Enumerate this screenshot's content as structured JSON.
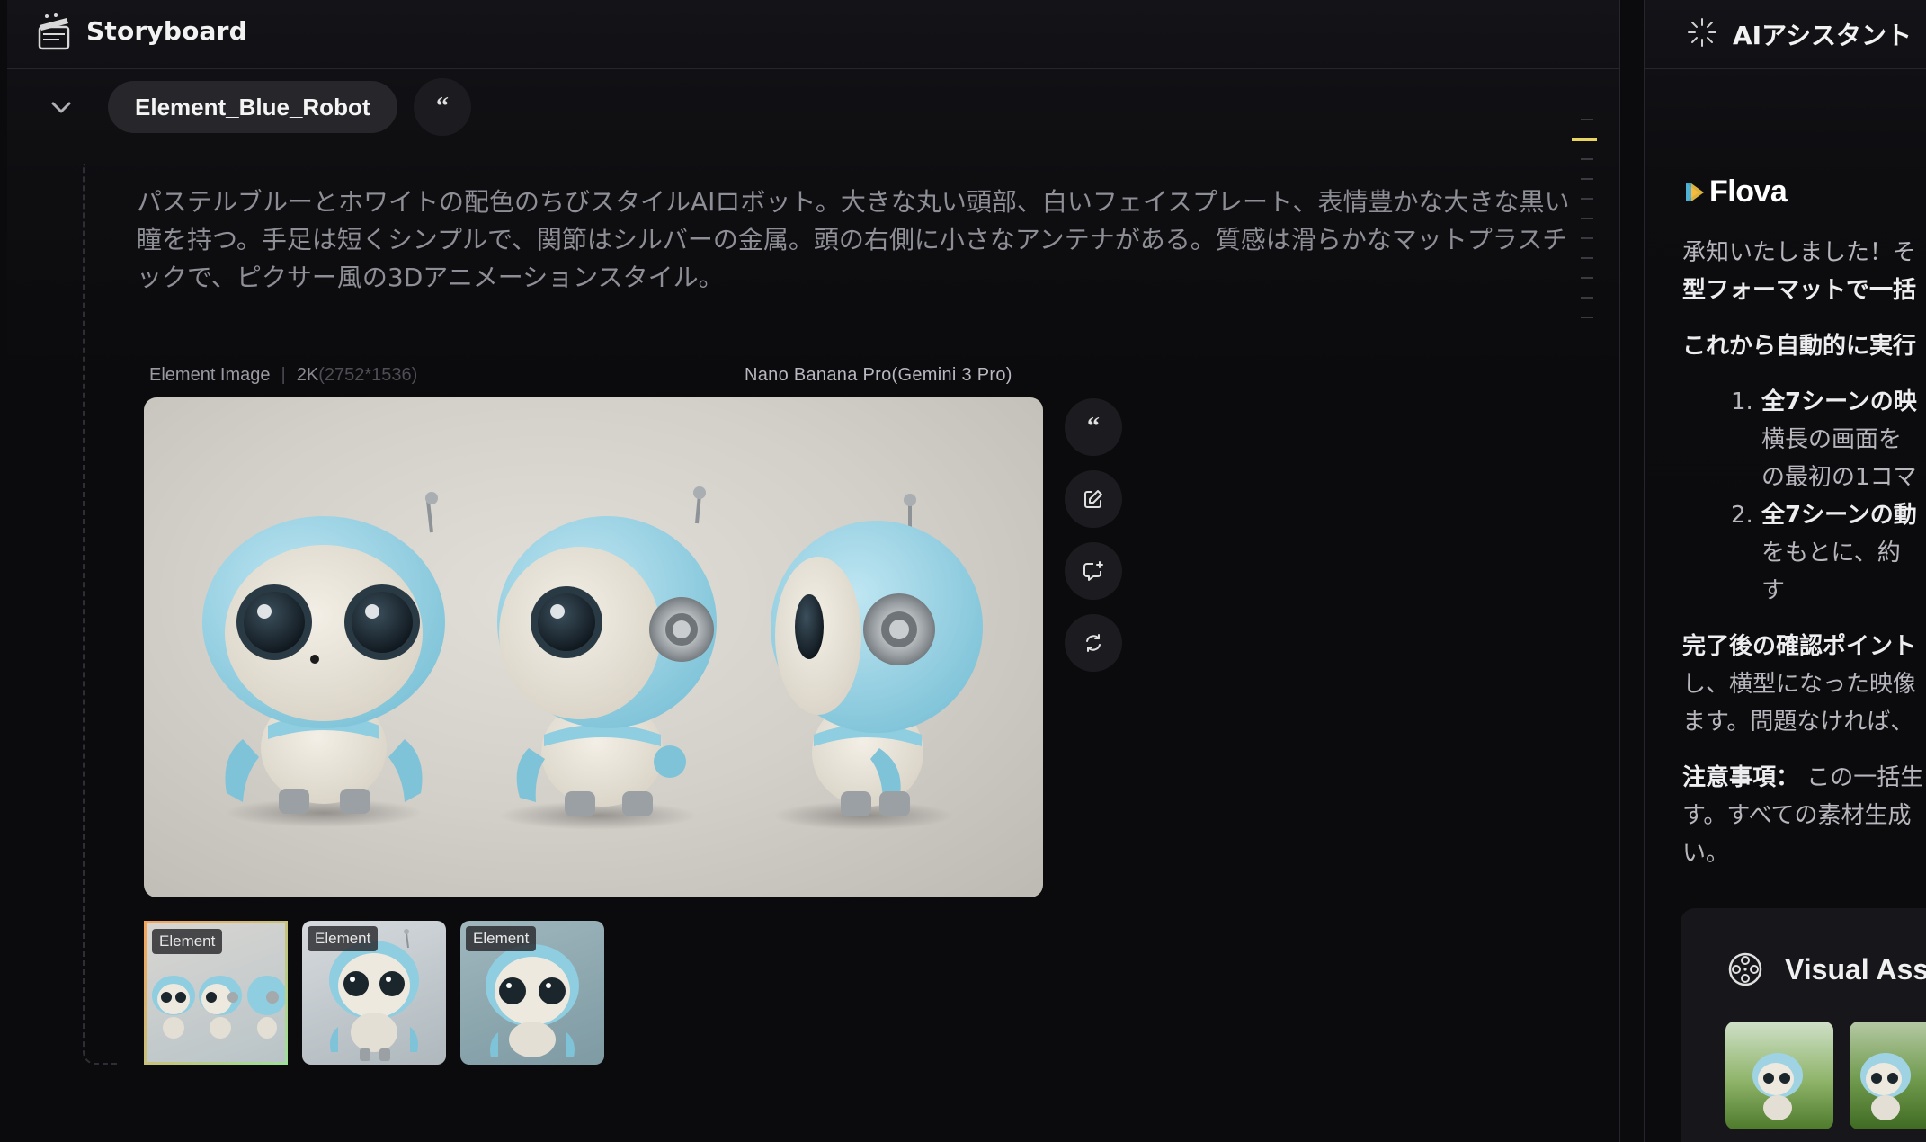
{
  "storyboard": {
    "title": "Storyboard",
    "element_name": "Element_Blue_Robot",
    "description": "パステルブルーとホワイトの配色のちびスタイルAIロボット。大きな丸い頭部、白いフェイスプレート、表情豊かな大きな黒い瞳を持つ。手足は短くシンプルで、関節はシルバーの金属。頭の右側に小さなアンテナがある。質感は滑らかなマットプラスチックで、ピクサー風の3Dアニメーションスタイル。",
    "image": {
      "label": "Element Image",
      "resolution": "2K",
      "dimensions": "(2752*1536)",
      "model": "Nano Banana Pro(Gemini 3 Pro)"
    },
    "thumbnails": [
      {
        "tag": "Element",
        "selected": true
      },
      {
        "tag": "Element",
        "selected": false
      },
      {
        "tag": "Element",
        "selected": false
      }
    ],
    "icons": {
      "header": "clapperboard-icon",
      "collapse": "chevron-down-icon",
      "quote": "quote-icon",
      "edit": "edit-icon",
      "chat": "chat-plus-icon",
      "regenerate": "refresh-icon"
    }
  },
  "assistant": {
    "title": "AIアシスタント",
    "brand": "Flova",
    "p1_line1": "承知いたしました！そ",
    "p1_line2": "型フォーマットで一括",
    "p2": "これから自動的に実行",
    "list": [
      {
        "num": "1.",
        "line1": "全7シーンの映",
        "line2": "横長の画面を",
        "line3": "の最初の1コマ"
      },
      {
        "num": "2.",
        "line1": "全7シーンの動",
        "line2": "をもとに、約",
        "line3": "す"
      }
    ],
    "p3_line1": "完了後の確認ポイント",
    "p3_line2": "し、横型になった映像",
    "p3_line3": "ます。問題なければ、",
    "p4_label": "注意事項：",
    "p4_line1": "この一括生",
    "p4_line2": "す。すべての素材生成",
    "p4_line3": "い。",
    "visual_title": "Visual Ass"
  },
  "colors": {
    "accent_yellow": "#e8d460",
    "panel_bg": "#0b0b0d",
    "pill_bg": "#26262b"
  }
}
